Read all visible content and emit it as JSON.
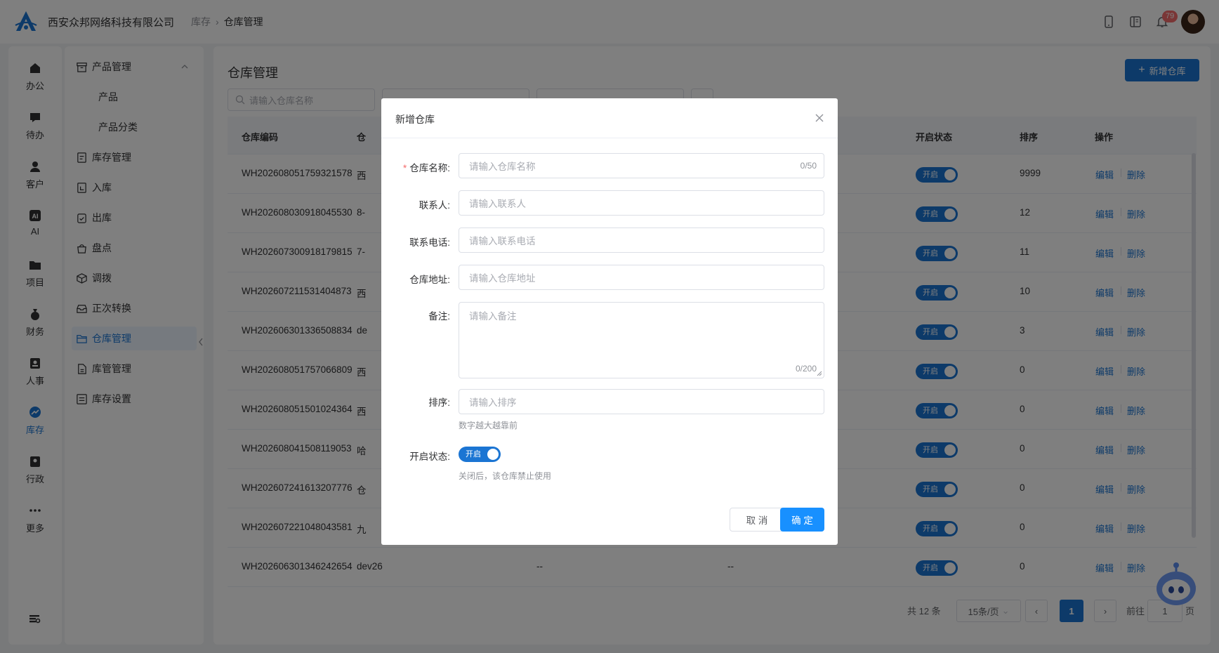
{
  "header": {
    "company": "西安众邦网络科技有限公司",
    "breadcrumb": [
      "库存",
      "仓库管理"
    ],
    "notification_count": "79",
    "colors": {
      "primary": "#1b75d3",
      "badge": "#f56c6c"
    }
  },
  "nav": {
    "items": [
      {
        "label": "办公",
        "icon": "house-icon"
      },
      {
        "label": "待办",
        "icon": "chat-bubble-icon"
      },
      {
        "label": "客户",
        "icon": "person-icon"
      },
      {
        "label": "AI",
        "icon": "ai-icon"
      },
      {
        "label": "项目",
        "icon": "folder-icon"
      },
      {
        "label": "财务",
        "icon": "money-bag-icon"
      },
      {
        "label": "人事",
        "icon": "badge-icon"
      },
      {
        "label": "库存",
        "icon": "inventory-chart-icon",
        "active": true
      },
      {
        "label": "行政",
        "icon": "admin-icon"
      },
      {
        "label": "更多",
        "icon": "more-dots-icon"
      }
    ]
  },
  "submenu": {
    "group": "产品管理",
    "children": [
      "产品",
      "产品分类"
    ],
    "items": [
      "库存管理",
      "入库",
      "出库",
      "盘点",
      "调拨",
      "正次转换",
      "仓库管理",
      "库管管理",
      "库存设置"
    ],
    "active": "仓库管理"
  },
  "main": {
    "title": "仓库管理",
    "add_button": "新增仓库",
    "search_placeholder": "请输入仓库名称",
    "columns": {
      "code": "仓库编码",
      "name": "仓",
      "status": "开启状态",
      "sort": "排序",
      "action": "操作"
    },
    "rows": [
      {
        "code": "WH202608051759321578",
        "name": "西",
        "status": "开启",
        "sort": "9999"
      },
      {
        "code": "WH202608030918045530",
        "name": "8-",
        "status": "开启",
        "sort": "12"
      },
      {
        "code": "WH202607300918179815",
        "name": "7-",
        "status": "开启",
        "sort": "11"
      },
      {
        "code": "WH202607211531404873",
        "name": "西",
        "status": "开启",
        "sort": "10"
      },
      {
        "code": "WH202606301336508834",
        "name": "de",
        "status": "开启",
        "sort": "3"
      },
      {
        "code": "WH202608051757066809",
        "name": "西",
        "status": "开启",
        "sort": "0"
      },
      {
        "code": "WH202608051501024364",
        "name": "西",
        "status": "开启",
        "sort": "0"
      },
      {
        "code": "WH202608041508119053",
        "name": "哈",
        "status": "开启",
        "sort": "0"
      },
      {
        "code": "WH202607241613207776",
        "name": "仓",
        "status": "开启",
        "sort": "0"
      },
      {
        "code": "WH202607221048043581",
        "name": "九",
        "status": "开启",
        "sort": "0"
      },
      {
        "code": "WH202606301346242654",
        "name": "dev26",
        "contact": "--",
        "phone": "--",
        "status": "开启",
        "sort": "0"
      }
    ],
    "edit_label": "编辑",
    "delete_label": "删除",
    "pagination": {
      "total": "共 12 条",
      "page_size": "15条/页",
      "current": "1",
      "goto_prefix": "前往",
      "goto_value": "1",
      "goto_suffix": "页"
    }
  },
  "dialog": {
    "title": "新增仓库",
    "fields": [
      {
        "label": "仓库名称:",
        "required": true,
        "placeholder": "请输入仓库名称",
        "counter": "0/50"
      },
      {
        "label": "联系人:",
        "placeholder": "请输入联系人"
      },
      {
        "label": "联系电话:",
        "placeholder": "请输入联系电话"
      },
      {
        "label": "仓库地址:",
        "placeholder": "请输入仓库地址"
      },
      {
        "label": "备注:",
        "placeholder": "请输入备注",
        "counter": "0/200"
      },
      {
        "label": "排序:",
        "placeholder": "请输入排序",
        "hint": "数字越大越靠前"
      }
    ],
    "status": {
      "label": "开启状态:",
      "value": "开启",
      "hint": "关闭后，该仓库禁止使用"
    },
    "cancel": "取 消",
    "confirm": "确 定"
  }
}
